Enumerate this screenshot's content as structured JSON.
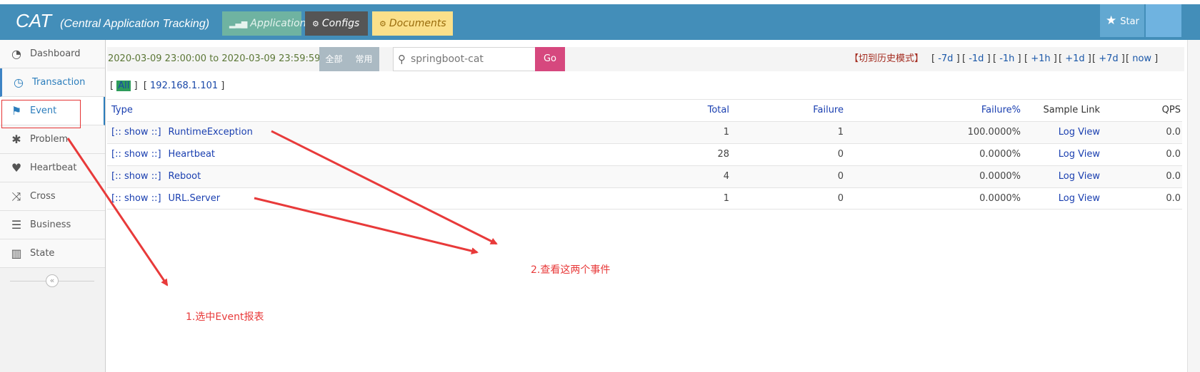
{
  "header": {
    "brand": "CAT",
    "brand_sub": "(Central Application Tracking)",
    "nav": [
      {
        "label": "Application",
        "icon": "signal-icon"
      },
      {
        "label": "Configs",
        "icon": "cogs-icon"
      },
      {
        "label": "Documents",
        "icon": "cogs-icon"
      }
    ],
    "star_label": "Star"
  },
  "sidebar": {
    "items": [
      {
        "label": "Dashboard",
        "icon": "dashboard-icon"
      },
      {
        "label": "Transaction",
        "icon": "clock-icon"
      },
      {
        "label": "Event",
        "icon": "flag-icon"
      },
      {
        "label": "Problem",
        "icon": "bug-icon"
      },
      {
        "label": "Heartbeat",
        "icon": "heart-icon"
      },
      {
        "label": "Cross",
        "icon": "random-icon"
      },
      {
        "label": "Business",
        "icon": "list-icon"
      },
      {
        "label": "State",
        "icon": "bar-chart-icon"
      }
    ],
    "collapse_icon": "double-angle-left-icon"
  },
  "toolbar": {
    "time_range": "2020-03-09 23:00:00 to 2020-03-09 23:59:59",
    "seg_all": "全部",
    "seg_common": "常用",
    "search_value": "springboot-cat",
    "go_label": "Go",
    "history_label": "【切到历史模式】",
    "quick_links": [
      "-7d",
      "-1d",
      "-1h",
      "+1h",
      "+1d",
      "+7d",
      "now"
    ]
  },
  "ip_filter": {
    "all_label": "All",
    "ip": "192.168.1.101"
  },
  "table": {
    "headers": [
      "Type",
      "Total",
      "Failure",
      "Failure%",
      "Sample Link",
      "QPS"
    ],
    "show_label": "[:: show ::]",
    "rows": [
      {
        "type": "RuntimeException",
        "total": "1",
        "failure": "1",
        "failure_pct": "100.0000%",
        "sample": "Log View",
        "qps": "0.0"
      },
      {
        "type": "Heartbeat",
        "total": "28",
        "failure": "0",
        "failure_pct": "0.0000%",
        "sample": "Log View",
        "qps": "0.0"
      },
      {
        "type": "Reboot",
        "total": "4",
        "failure": "0",
        "failure_pct": "0.0000%",
        "sample": "Log View",
        "qps": "0.0"
      },
      {
        "type": "URL.Server",
        "total": "1",
        "failure": "0",
        "failure_pct": "0.0000%",
        "sample": "Log View",
        "qps": "0.0"
      }
    ]
  },
  "annotations": {
    "note1": "1.选中Event报表",
    "note2": "2.查看这两个事件",
    "color": "#e83a3a"
  }
}
